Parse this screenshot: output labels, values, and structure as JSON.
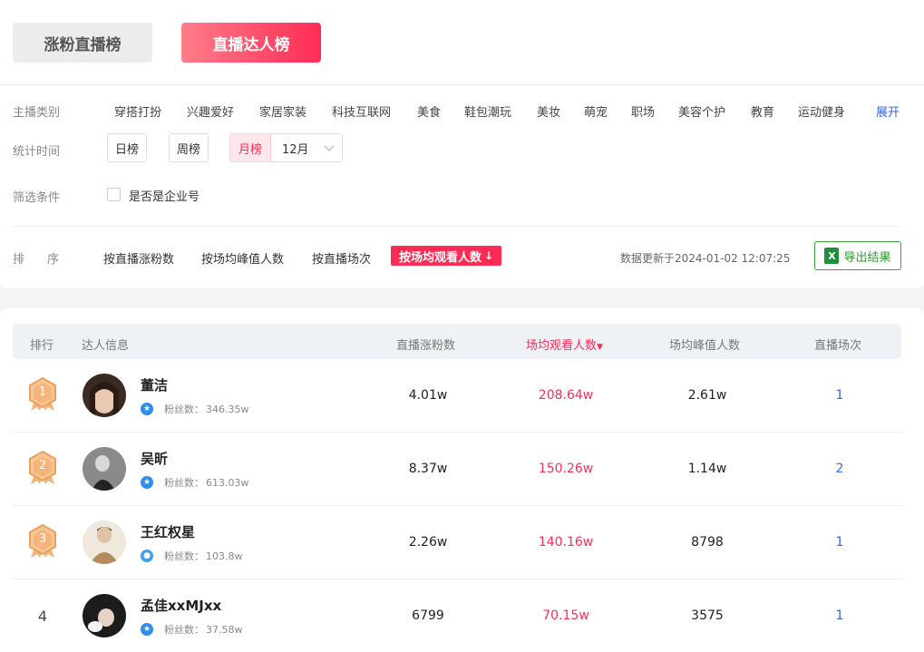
{
  "tabs": {
    "fans_rank": "涨粉直播榜",
    "talent_rank": "直播达人榜"
  },
  "filters": {
    "category_label": "主播类别",
    "categories": [
      "穿搭打扮",
      "兴趣爱好",
      "家居家装",
      "科技互联网",
      "美食",
      "鞋包潮玩",
      "美妆",
      "萌宠",
      "职场",
      "美容个护",
      "教育",
      "运动健身"
    ],
    "expand": "展开",
    "time_label": "统计时间",
    "day": "日榜",
    "week": "周榜",
    "month": "月榜",
    "month_value": "12月",
    "condition_label": "筛选条件",
    "enterprise": "是否是企业号"
  },
  "sort": {
    "label_1": "排",
    "label_2": "序",
    "options": [
      "按直播涨粉数",
      "按场均峰值人数",
      "按直播场次"
    ],
    "active": "按场均观看人数",
    "updated": "数据更新于2024-01-02 12:07:25",
    "export": "导出结果",
    "export_icon": "X"
  },
  "table": {
    "headers": {
      "rank": "排行",
      "info": "达人信息",
      "fans_gain": "直播涨粉数",
      "avg_view": "场均观看人数",
      "avg_peak": "场均峰值人数",
      "sessions": "直播场次"
    },
    "fans_label": "粉丝数：",
    "rows": [
      {
        "rank": "1",
        "name": "董洁",
        "fans": "346.35w",
        "fans_gain": "4.01w",
        "avg_view": "208.64w",
        "avg_peak": "2.61w",
        "sessions": "1"
      },
      {
        "rank": "2",
        "name": "吴昕",
        "fans": "613.03w",
        "fans_gain": "8.37w",
        "avg_view": "150.26w",
        "avg_peak": "1.14w",
        "sessions": "2"
      },
      {
        "rank": "3",
        "name": "王红权星",
        "fans": "103.8w",
        "fans_gain": "2.26w",
        "avg_view": "140.16w",
        "avg_peak": "8798",
        "sessions": "1"
      },
      {
        "rank": "4",
        "name": "孟佳xxMJxx",
        "fans": "37.58w",
        "fans_gain": "6799",
        "avg_view": "70.15w",
        "avg_peak": "3575",
        "sessions": "1"
      }
    ]
  },
  "colors": {
    "accent": "#fe2c55",
    "link": "#3a63e6",
    "export": "#2f9a2f",
    "medal": "#f4b679"
  }
}
